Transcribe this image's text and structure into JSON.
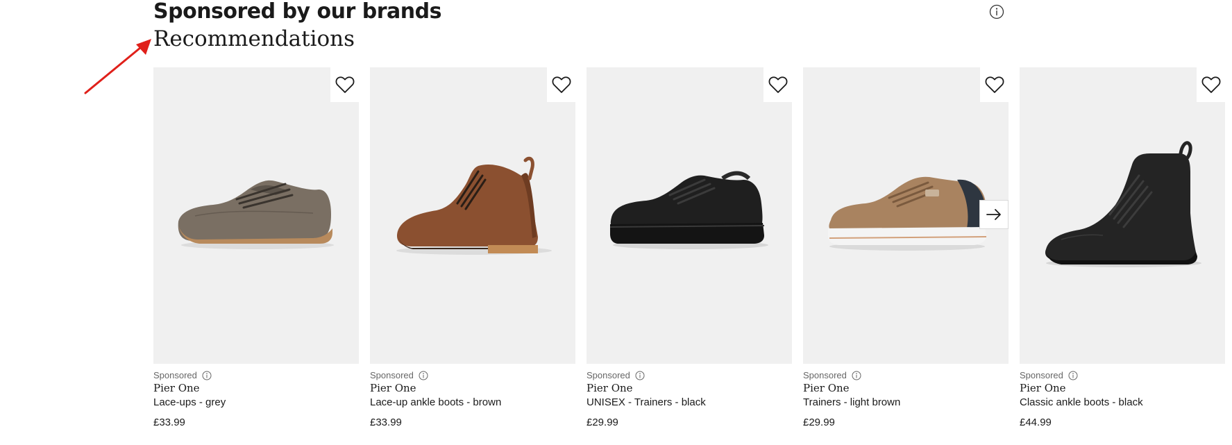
{
  "section": {
    "title": "Sponsored by our brands",
    "subtitle": "Recommendations"
  },
  "annotation": {
    "arrow_color": "#e0201a"
  },
  "colors": {
    "image_bg": "#f0f0f0",
    "text": "#1a1a1a",
    "muted": "#666666"
  },
  "icons": {
    "info": "info-circle-icon",
    "wishlist": "heart-outline-icon",
    "next": "arrow-right-icon"
  },
  "products": [
    {
      "sponsored": "Sponsored",
      "brand": "Pier One",
      "name": "Lace-ups - grey",
      "price": "£33.99",
      "image": "grey-derby-shoe"
    },
    {
      "sponsored": "Sponsored",
      "brand": "Pier One",
      "name": "Lace-up ankle boots - brown",
      "price": "£33.99",
      "image": "brown-chukka-boot"
    },
    {
      "sponsored": "Sponsored",
      "brand": "Pier One",
      "name": "UNISEX - Trainers - black",
      "price": "£29.99",
      "image": "black-trainer"
    },
    {
      "sponsored": "Sponsored",
      "brand": "Pier One",
      "name": "Trainers - light brown",
      "price": "£29.99",
      "image": "light-brown-trainer"
    },
    {
      "sponsored": "Sponsored",
      "brand": "Pier One",
      "name": "Classic ankle boots - black",
      "price": "£44.99",
      "image": "black-ankle-boot"
    }
  ]
}
